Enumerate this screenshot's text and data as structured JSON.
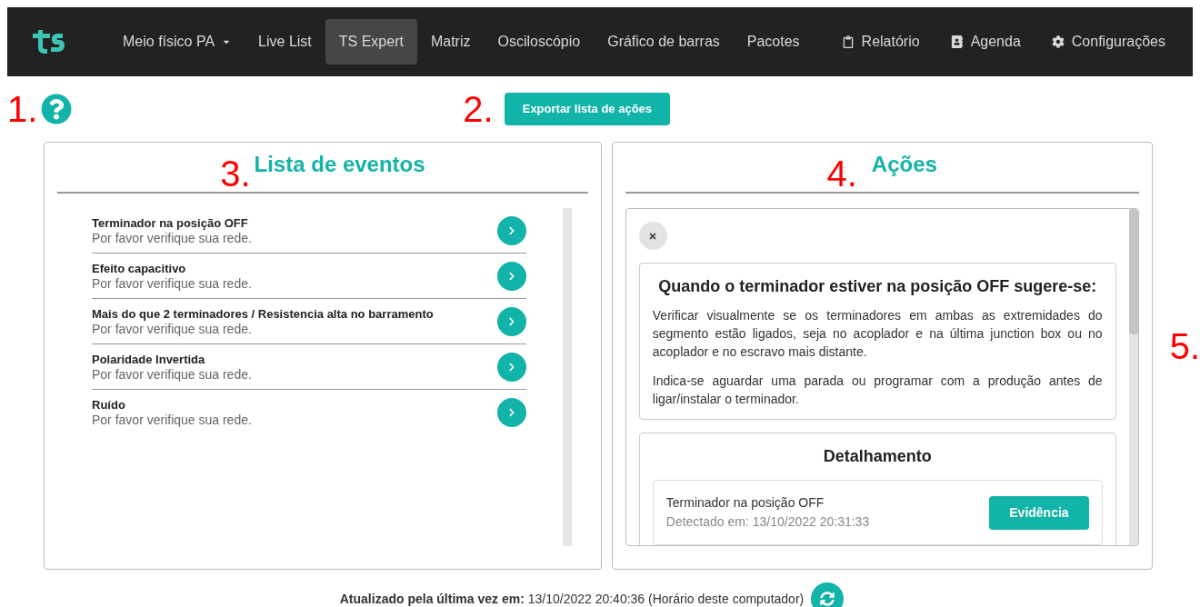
{
  "navbar": {
    "items": [
      {
        "label": "Meio físico PA",
        "selected": false,
        "kind": "dropdown"
      },
      {
        "label": "Live List",
        "selected": false,
        "kind": "plain"
      },
      {
        "label": "TS Expert",
        "selected": true,
        "kind": "plain"
      },
      {
        "label": "Matriz",
        "selected": false,
        "kind": "plain"
      },
      {
        "label": "Osciloscópio",
        "selected": false,
        "kind": "plain"
      },
      {
        "label": "Gráfico de barras",
        "selected": false,
        "kind": "plain"
      },
      {
        "label": "Pacotes",
        "selected": false,
        "kind": "plain"
      },
      {
        "label": "Relatório",
        "selected": false,
        "kind": "clipboard"
      },
      {
        "label": "Agenda",
        "selected": false,
        "kind": "contact"
      },
      {
        "label": "Configurações",
        "selected": false,
        "kind": "gear"
      }
    ]
  },
  "annotations": [
    "1.",
    "2.",
    "3.",
    "4.",
    "5."
  ],
  "export_button": "Exportar lista de ações",
  "events_panel": {
    "title": "Lista de eventos",
    "events": [
      {
        "title": "Terminador na posição OFF",
        "subtitle": "Por favor verifique sua rede."
      },
      {
        "title": "Efeito capacitivo",
        "subtitle": "Por favor verifique sua rede."
      },
      {
        "title": "Mais do que 2 terminadores / Resistencia alta no barramento",
        "subtitle": "Por favor verifique sua rede."
      },
      {
        "title": "Polaridade Invertida",
        "subtitle": "Por favor verifique sua rede."
      },
      {
        "title": "Ruído",
        "subtitle": "Por favor verifique sua rede."
      }
    ]
  },
  "actions_panel": {
    "title": "Ações",
    "suggestion": {
      "title": "Quando o terminador estiver na posição OFF sugere-se:",
      "paragraphs": [
        "Verificar visualmente se os terminadores em ambas as extremidades do segmento estão ligados, seja no acoplador e na última junction box ou no acoplador e no escravo mais distante.",
        "Indica-se aguardar uma parada ou programar com a produção antes de ligar/instalar o terminador."
      ]
    },
    "details": {
      "title": "Detalhamento",
      "event": "Terminador na posição OFF",
      "detected": "Detectado em: 13/10/2022 20:31:33",
      "button": "Evidência"
    }
  },
  "footer": {
    "label": "**Atualizado pela última vez em:** 13/10/2022 20:40:36 (Horário deste computador)"
  }
}
